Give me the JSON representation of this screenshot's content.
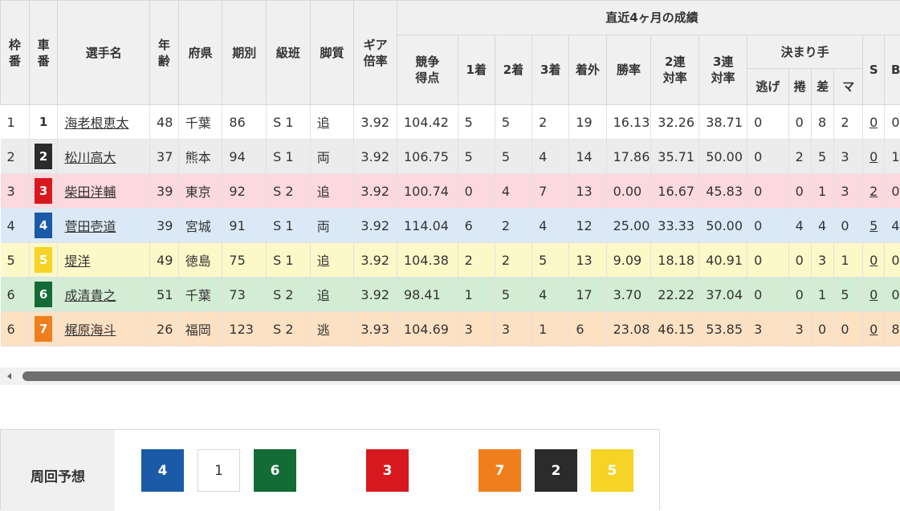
{
  "headers": {
    "waku": "枠番",
    "sha": "車番",
    "name": "選手名",
    "age": "年齢",
    "pref": "府県",
    "term": "期別",
    "class": "級班",
    "style": "脚質",
    "gear": "ギア倍率",
    "group": "直近4ヶ月の成績",
    "score": "競争得点",
    "first": "1着",
    "second": "2着",
    "third": "3着",
    "out": "着外",
    "winrate": "勝率",
    "ren2": "2連対率",
    "ren3": "3連対率",
    "kimarite": "決まり手",
    "nige": "逃げ",
    "makuri": "捲",
    "sashi": "差",
    "mark": "マ",
    "s": "S",
    "b": "B"
  },
  "rows": [
    {
      "waku": "1",
      "car": "1",
      "name": "海老根恵太",
      "age": "48",
      "pref": "千葉",
      "term": "86",
      "class": "S 1",
      "style": "追",
      "gear": "3.92",
      "score": "104.42",
      "first": "5",
      "second": "5",
      "third": "2",
      "out": "19",
      "winrate": "16.13",
      "ren2": "32.26",
      "ren3": "38.71",
      "nige": "0",
      "makuri": "0",
      "sashi": "8",
      "mark": "2",
      "s": "0",
      "b": "0"
    },
    {
      "waku": "2",
      "car": "2",
      "name": "松川高大",
      "age": "37",
      "pref": "熊本",
      "term": "94",
      "class": "S 1",
      "style": "両",
      "gear": "3.92",
      "score": "106.75",
      "first": "5",
      "second": "5",
      "third": "4",
      "out": "14",
      "winrate": "17.86",
      "ren2": "35.71",
      "ren3": "50.00",
      "nige": "0",
      "makuri": "2",
      "sashi": "5",
      "mark": "3",
      "s": "0",
      "b": "1"
    },
    {
      "waku": "3",
      "car": "3",
      "name": "柴田洋輔",
      "age": "39",
      "pref": "東京",
      "term": "92",
      "class": "S 2",
      "style": "追",
      "gear": "3.92",
      "score": "100.74",
      "first": "0",
      "second": "4",
      "third": "7",
      "out": "13",
      "winrate": "0.00",
      "ren2": "16.67",
      "ren3": "45.83",
      "nige": "0",
      "makuri": "0",
      "sashi": "1",
      "mark": "3",
      "s": "2",
      "b": "0"
    },
    {
      "waku": "4",
      "car": "4",
      "name": "菅田壱道",
      "age": "39",
      "pref": "宮城",
      "term": "91",
      "class": "S 1",
      "style": "両",
      "gear": "3.92",
      "score": "114.04",
      "first": "6",
      "second": "2",
      "third": "4",
      "out": "12",
      "winrate": "25.00",
      "ren2": "33.33",
      "ren3": "50.00",
      "nige": "0",
      "makuri": "4",
      "sashi": "4",
      "mark": "0",
      "s": "5",
      "b": "4"
    },
    {
      "waku": "5",
      "car": "5",
      "name": "堤洋",
      "age": "49",
      "pref": "徳島",
      "term": "75",
      "class": "S 1",
      "style": "追",
      "gear": "3.92",
      "score": "104.38",
      "first": "2",
      "second": "2",
      "third": "5",
      "out": "13",
      "winrate": "9.09",
      "ren2": "18.18",
      "ren3": "40.91",
      "nige": "0",
      "makuri": "0",
      "sashi": "3",
      "mark": "1",
      "s": "0",
      "b": "0"
    },
    {
      "waku": "6",
      "car": "6",
      "name": "成清貴之",
      "age": "51",
      "pref": "千葉",
      "term": "73",
      "class": "S 2",
      "style": "追",
      "gear": "3.92",
      "score": "98.41",
      "first": "1",
      "second": "5",
      "third": "4",
      "out": "17",
      "winrate": "3.70",
      "ren2": "22.22",
      "ren3": "37.04",
      "nige": "0",
      "makuri": "0",
      "sashi": "1",
      "mark": "5",
      "s": "0",
      "b": "0"
    },
    {
      "waku": "6",
      "car": "7",
      "name": "梶原海斗",
      "age": "26",
      "pref": "福岡",
      "term": "123",
      "class": "S 2",
      "style": "逃",
      "gear": "3.93",
      "score": "104.69",
      "first": "3",
      "second": "3",
      "third": "1",
      "out": "6",
      "winrate": "23.08",
      "ren2": "46.15",
      "ren3": "53.85",
      "nige": "3",
      "makuri": "3",
      "sashi": "0",
      "mark": "0",
      "s": "0",
      "b": "8"
    }
  ],
  "car_colors": {
    "1": {
      "bg": "#ffffff",
      "fg": "#333333",
      "border": "#ffffff"
    },
    "2": {
      "bg": "#2b2b2b",
      "fg": "#ffffff",
      "border": "#2b2b2b"
    },
    "3": {
      "bg": "#d7191f",
      "fg": "#ffffff",
      "border": "#d7191f"
    },
    "4": {
      "bg": "#1a5aa6",
      "fg": "#ffffff",
      "border": "#1a5aa6"
    },
    "5": {
      "bg": "#f5d327",
      "fg": "#ffffff",
      "border": "#f5d327"
    },
    "6": {
      "bg": "#136b35",
      "fg": "#ffffff",
      "border": "#136b35"
    },
    "7": {
      "bg": "#ee7f1c",
      "fg": "#ffffff",
      "border": "#ee7f1c"
    }
  },
  "prediction": {
    "label": "周回予想",
    "order": [
      "4",
      "1",
      "6",
      "",
      "3",
      "",
      "7",
      "2",
      "5"
    ]
  }
}
